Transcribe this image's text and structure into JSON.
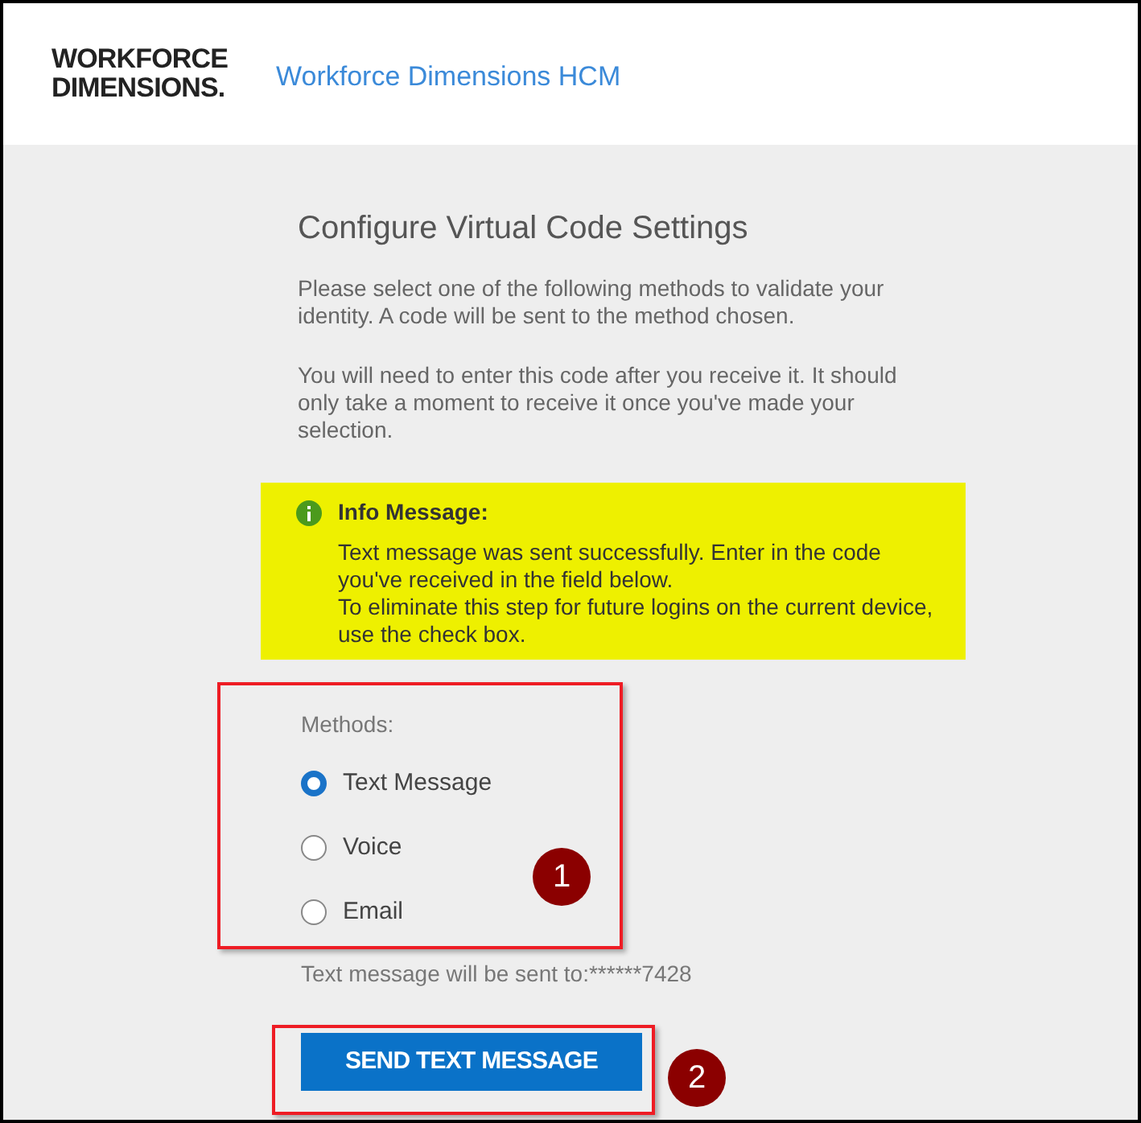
{
  "header": {
    "logo_lines": [
      "WORKFORCE",
      "DIMENSIONS."
    ],
    "app_title": "Workforce Dimensions HCM"
  },
  "heading": "Configure Virtual Code Settings",
  "paragraphs": [
    "Please select one of the following methods to validate your identity. A code will be sent to the method chosen.",
    "You will need to enter this code after you receive it. It should only take a moment to receive it once you've made your selection."
  ],
  "info_message": {
    "title": "Info Message:",
    "lines": [
      "Text message was sent successfully. Enter in the code you've received in the field below.",
      "To eliminate this step for future logins on the current device, use the check box."
    ]
  },
  "methods": {
    "label": "Methods:",
    "options": [
      {
        "label": "Text Message",
        "selected": true
      },
      {
        "label": "Voice",
        "selected": false
      },
      {
        "label": "Email",
        "selected": false
      }
    ]
  },
  "send_note": "Text message will be sent to:******7428",
  "send_button": "SEND TEXT MESSAGE",
  "annotations": [
    "1",
    "2"
  ]
}
